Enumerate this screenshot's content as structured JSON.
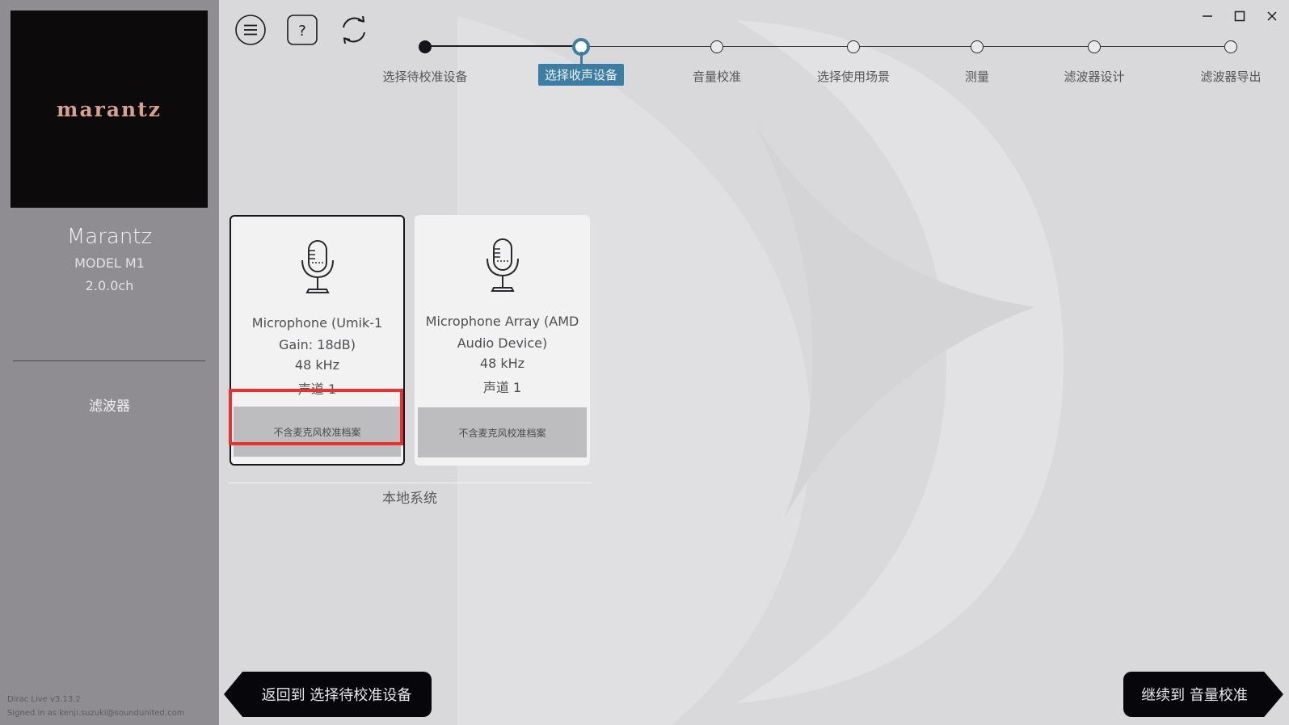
{
  "sidebar": {
    "logo_text": "marantz",
    "brand": "Marantz",
    "model": "MODEL M1",
    "channels": "2.0.0ch",
    "filter_label": "滤波器",
    "version": "Dirac Live v3.13.2",
    "signed_in": "Signed in as kenji.suzuki@soundunited.com"
  },
  "toolbar": {
    "menu_icon": "hamburger-menu-icon",
    "help_icon": "question-mark-icon",
    "refresh_icon": "refresh-icon",
    "help_glyph": "?"
  },
  "window": {
    "minimize_icon": "minimize-icon",
    "maximize_icon": "maximize-icon",
    "close_icon": "close-icon"
  },
  "steps": [
    {
      "label": "选择待校准设备",
      "state": "done"
    },
    {
      "label": "选择收声设备",
      "state": "current"
    },
    {
      "label": "音量校准",
      "state": "todo"
    },
    {
      "label": "选择使用场景",
      "state": "todo"
    },
    {
      "label": "测量",
      "state": "todo"
    },
    {
      "label": "滤波器设计",
      "state": "todo"
    },
    {
      "label": "滤波器导出",
      "state": "todo"
    }
  ],
  "devices": [
    {
      "name_line1": "Microphone (Umik-1",
      "name_line2": "Gain: 18dB)",
      "rate": "48 kHz",
      "channel": "声道 1",
      "calibration": "不含麦克风校准档案",
      "selected": true
    },
    {
      "name_line1": "Microphone Array (AMD",
      "name_line2": "Audio Device)",
      "rate": "48 kHz",
      "channel": "声道 1",
      "calibration": "不含麦克风校准档案",
      "selected": false
    }
  ],
  "group_label": "本地系统",
  "nav": {
    "back_label": "返回到 选择待校准设备",
    "next_label": "继续到 音量校准"
  },
  "colors": {
    "accent": "#3c7ea3",
    "sidebar": "#8f8d92",
    "background": "#d9d8db",
    "highlight": "#e8322f",
    "nav_button": "#07070b"
  }
}
